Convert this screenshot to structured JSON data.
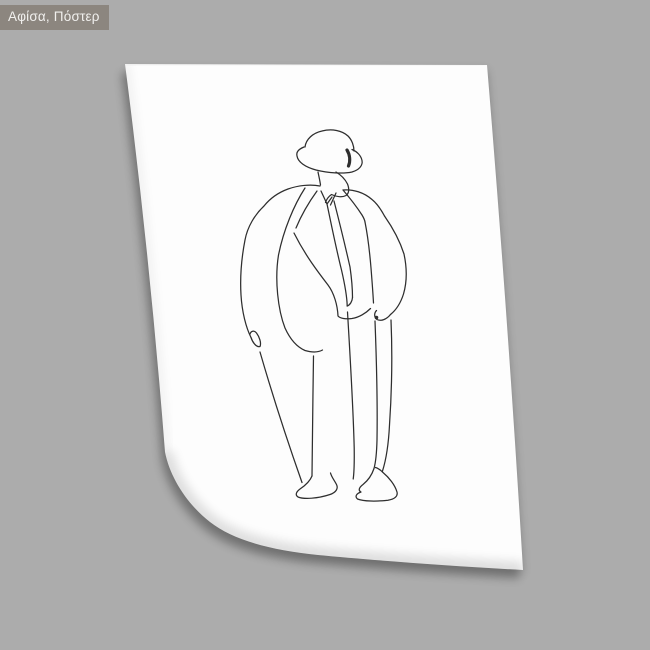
{
  "badge": {
    "label": "Αφίσα, Πόστερ"
  },
  "poster": {
    "artwork_name": "one-line-man-in-suit-and-hat",
    "description": "Continuous single-line drawing of a man wearing a fedora hat and suit with tie, head turned in profile, one hand at his pocket, on a white curled paper sheet"
  },
  "colors": {
    "background": "#acacac",
    "badge_background": "#8a847c",
    "badge_text": "#f7f6f4",
    "paper": "#fdfdfd",
    "line_art": "#2e2e2e",
    "shadow": "#000000"
  }
}
